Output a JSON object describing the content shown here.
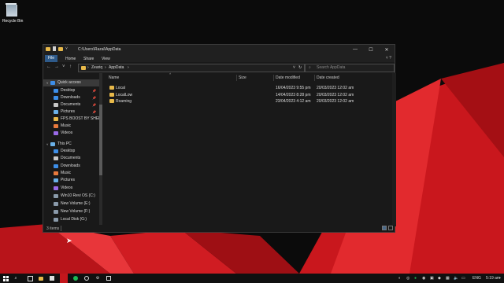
{
  "desktop": {
    "recycle_bin_label": "Recycle Bin"
  },
  "window": {
    "title_path": "C:\\Users\\Razal\\AppData",
    "controls": {
      "minimize": "—",
      "maximize": "☐",
      "close": "✕"
    }
  },
  "ribbon": {
    "tabs": [
      "File",
      "Home",
      "Share",
      "View"
    ]
  },
  "address": {
    "segments": [
      "Zeariq",
      "AppData"
    ],
    "refresh_icon": "refresh-icon",
    "search_placeholder": "Search AppData"
  },
  "nav": {
    "quick_access": "Quick access",
    "quick_items": [
      "Desktop",
      "Downloads",
      "Documents",
      "Pictures",
      "FPS BOOST BY SHEES",
      "Music",
      "Videos"
    ],
    "this_pc": "This PC",
    "pc_items": [
      "Desktop",
      "Documents",
      "Downloads",
      "Music",
      "Pictures",
      "Videos",
      "Win10 Revi OS (C:)",
      "New Volume (E:)",
      "New Volume (F:)",
      "Local Disk (G:)"
    ]
  },
  "columns": {
    "name": "Name",
    "size": "Size",
    "modified": "Date modified",
    "created": "Date created"
  },
  "files": [
    {
      "name": "Local",
      "modified": "16/04/2023 9:55 pm",
      "created": "20/03/2023 12:02 am"
    },
    {
      "name": "LocalLow",
      "modified": "14/04/2023 8:28 pm",
      "created": "20/03/2023 12:02 am"
    },
    {
      "name": "Roaming",
      "modified": "23/04/2023 4:12 am",
      "created": "20/03/2023 12:02 am"
    }
  ],
  "status": {
    "count": "3 items"
  },
  "taskbar": {
    "lang": "ENG",
    "time": "5:19 am",
    "colors": {
      "start": "#ffffff",
      "active_app": "#c4161c"
    }
  }
}
